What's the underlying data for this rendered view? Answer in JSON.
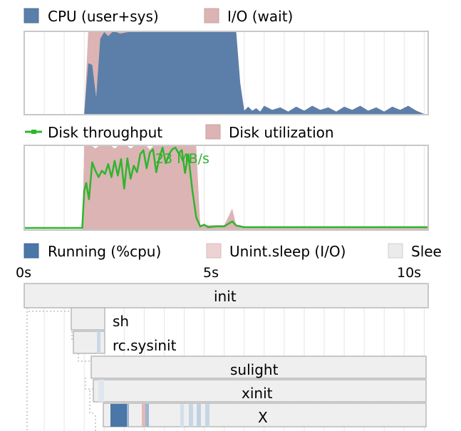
{
  "colors": {
    "cpu": "#5b7fa8",
    "io_wait": "#dcb4b4",
    "disk_throughput": "#2fb52f",
    "disk_util": "#dcb4b4",
    "running": "#4a76a8",
    "running_light": "#c9d8e6",
    "unint_sleep": "#ecd2d2",
    "sleep": "#ebebeb",
    "grid": "#e6e6e6",
    "frame": "#c8c8c8"
  },
  "legend_cpu": {
    "cpu_label": "CPU (user+sys)",
    "io_label": "I/O (wait)"
  },
  "legend_disk": {
    "throughput_label": "Disk throughput",
    "util_label": "Disk utilization"
  },
  "legend_proc": {
    "running_label": "Running (%cpu)",
    "unint_label": "Unint.sleep (I/O)",
    "sleep_label": "Slee"
  },
  "chart_data": [
    {
      "type": "area",
      "id": "cpu",
      "x": [
        0,
        1.5,
        1.6,
        1.7,
        1.8,
        1.9,
        2.0,
        2.1,
        2.2,
        2.3,
        2.4,
        2.6,
        2.8,
        3.0,
        3.5,
        4.0,
        4.5,
        5.0,
        5.3,
        5.4,
        5.5,
        5.6,
        5.7,
        5.8,
        5.9,
        6.0,
        6.2,
        6.4,
        6.6,
        6.8,
        7.0,
        7.2,
        7.4,
        7.6,
        7.8,
        8.0,
        8.2,
        8.4,
        8.6,
        8.8,
        9.0,
        9.2,
        9.4,
        9.6,
        9.8,
        10.0,
        10.1
      ],
      "series": [
        {
          "name": "CPU (user+sys)",
          "values": [
            0,
            0,
            62,
            60,
            20,
            92,
            100,
            95,
            100,
            100,
            98,
            100,
            100,
            100,
            100,
            100,
            100,
            100,
            100,
            38,
            4,
            9,
            4,
            7,
            3,
            10,
            5,
            8,
            3,
            9,
            4,
            10,
            5,
            8,
            3,
            9,
            5,
            10,
            4,
            8,
            3,
            9,
            5,
            10,
            4,
            0,
            0
          ]
        },
        {
          "name": "I/O (wait)",
          "values": [
            0,
            0,
            100,
            100,
            100,
            100,
            100,
            100,
            100,
            100,
            100,
            100,
            100,
            100,
            100,
            100,
            100,
            100,
            100,
            38,
            4,
            9,
            4,
            7,
            3,
            10,
            5,
            8,
            3,
            9,
            4,
            10,
            5,
            8,
            3,
            9,
            5,
            10,
            4,
            8,
            3,
            9,
            5,
            10,
            4,
            0,
            0
          ]
        }
      ]
    },
    {
      "type": "line",
      "id": "disk",
      "annotation": "23 MB/s",
      "x": [
        0,
        1.45,
        1.5,
        1.55,
        1.62,
        1.7,
        1.78,
        1.86,
        1.94,
        2.02,
        2.1,
        2.18,
        2.26,
        2.34,
        2.42,
        2.5,
        2.58,
        2.66,
        2.74,
        2.82,
        2.9,
        2.98,
        3.06,
        3.14,
        3.22,
        3.3,
        3.38,
        3.46,
        3.54,
        3.62,
        3.7,
        3.78,
        3.86,
        3.94,
        4.02,
        4.1,
        4.2,
        4.3,
        4.4,
        4.5,
        4.6,
        4.8,
        5.0,
        5.2,
        5.3,
        5.4,
        5.5,
        6.0,
        7.0,
        8.0,
        9.0,
        10.0,
        10.1
      ],
      "series": [
        {
          "name": "Disk throughput",
          "values": [
            0,
            0,
            45,
            55,
            35,
            80,
            70,
            62,
            70,
            66,
            78,
            62,
            82,
            64,
            84,
            48,
            85,
            60,
            76,
            68,
            90,
            95,
            73,
            92,
            96,
            68,
            86,
            98,
            79,
            90,
            96,
            98,
            91,
            95,
            67,
            90,
            47,
            13,
            2,
            4,
            1,
            2,
            2,
            8,
            3,
            2,
            1,
            1,
            1,
            1,
            1,
            1,
            1
          ]
        },
        {
          "name": "Disk utilization",
          "values": [
            0,
            0,
            100,
            100,
            100,
            100,
            97,
            100,
            100,
            100,
            100,
            100,
            97,
            100,
            100,
            100,
            100,
            97,
            100,
            100,
            100,
            100,
            100,
            96,
            100,
            100,
            100,
            100,
            100,
            100,
            100,
            100,
            100,
            100,
            100,
            100,
            100,
            100,
            5,
            5,
            5,
            5,
            5,
            25,
            5,
            5,
            2,
            2,
            2,
            2,
            2,
            2,
            2
          ]
        }
      ],
      "xlim": [
        0,
        10.1
      ],
      "ylim": [
        0,
        100
      ]
    },
    {
      "type": "bar",
      "id": "bootchart",
      "x_ticks": [
        "0s",
        "5s",
        "10s"
      ],
      "processes": [
        {
          "label": "init",
          "start": 0,
          "end": 10
        },
        {
          "label": "sh",
          "start": 1.15,
          "end": 2.0
        },
        {
          "label": "rc.sysinit",
          "start": 1.15,
          "end": 2.0
        },
        {
          "label": "sulight",
          "start": 1.65,
          "end": 10
        },
        {
          "label": "xinit",
          "start": 1.85,
          "end": 10
        },
        {
          "label": "X",
          "start": 1.95,
          "end": 10
        }
      ]
    }
  ]
}
